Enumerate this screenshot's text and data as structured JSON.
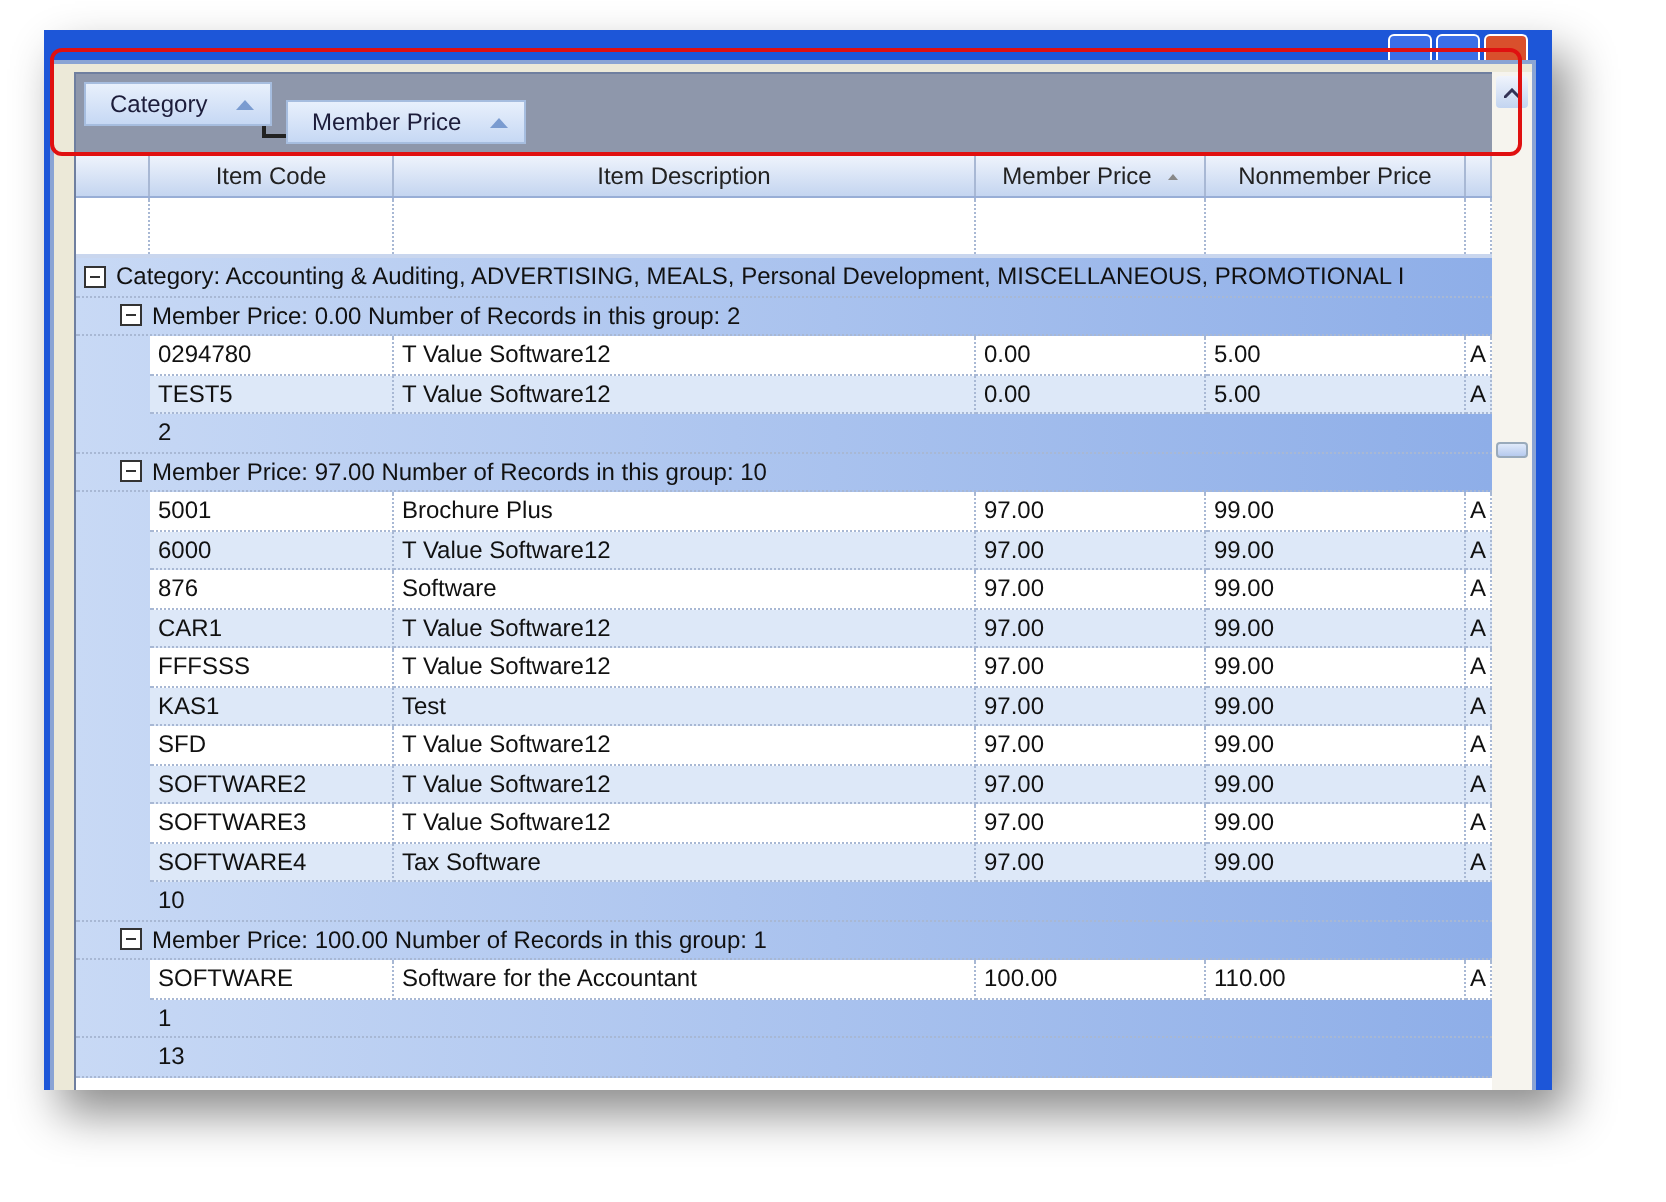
{
  "group_panel": [
    {
      "label": "Category",
      "sorted": true
    },
    {
      "label": "Member Price",
      "sorted": true
    }
  ],
  "columns": [
    {
      "label": "Item Code",
      "sorted": false
    },
    {
      "label": "Item Description",
      "sorted": false
    },
    {
      "label": "Member Price",
      "sorted": true
    },
    {
      "label": "Nonmember Price",
      "sorted": false
    }
  ],
  "category_group": {
    "label": "Category: Accounting & Auditing, ADVERTISING, MEALS, Personal Development, MISCELLANEOUS, PROMOTIONAL I",
    "expanded": true,
    "footer": "13",
    "groups": [
      {
        "label": "Member Price: 0.00 Number of Records in this group: 2",
        "expanded": true,
        "footer": "2",
        "rows": [
          [
            "0294780",
            "T Value Software12",
            "0.00",
            "5.00",
            "A"
          ],
          [
            "TEST5",
            "T Value Software12",
            "0.00",
            "5.00",
            "A"
          ]
        ]
      },
      {
        "label": "Member Price: 97.00 Number of Records in this group: 10",
        "expanded": true,
        "footer": "10",
        "rows": [
          [
            "5001",
            "Brochure Plus",
            "97.00",
            "99.00",
            "A"
          ],
          [
            "6000",
            "T Value Software12",
            "97.00",
            "99.00",
            "A"
          ],
          [
            "876",
            "Software",
            "97.00",
            "99.00",
            "A"
          ],
          [
            "CAR1",
            "T Value Software12",
            "97.00",
            "99.00",
            "A"
          ],
          [
            "FFFSSS",
            "T Value Software12",
            "97.00",
            "99.00",
            "A"
          ],
          [
            "KAS1",
            "Test",
            "97.00",
            "99.00",
            "A"
          ],
          [
            "SFD",
            "T Value Software12",
            "97.00",
            "99.00",
            "A"
          ],
          [
            "SOFTWARE2",
            "T Value Software12",
            "97.00",
            "99.00",
            "A"
          ],
          [
            "SOFTWARE3",
            "T Value Software12",
            "97.00",
            "99.00",
            "A"
          ],
          [
            "SOFTWARE4",
            "Tax Software",
            "97.00",
            "99.00",
            "A"
          ]
        ]
      },
      {
        "label": "Member Price: 100.00 Number of Records in this group: 1",
        "expanded": true,
        "footer": "1",
        "rows": [
          [
            "SOFTWARE",
            "Software for the Accountant",
            "100.00",
            "110.00",
            "A"
          ]
        ]
      }
    ]
  }
}
